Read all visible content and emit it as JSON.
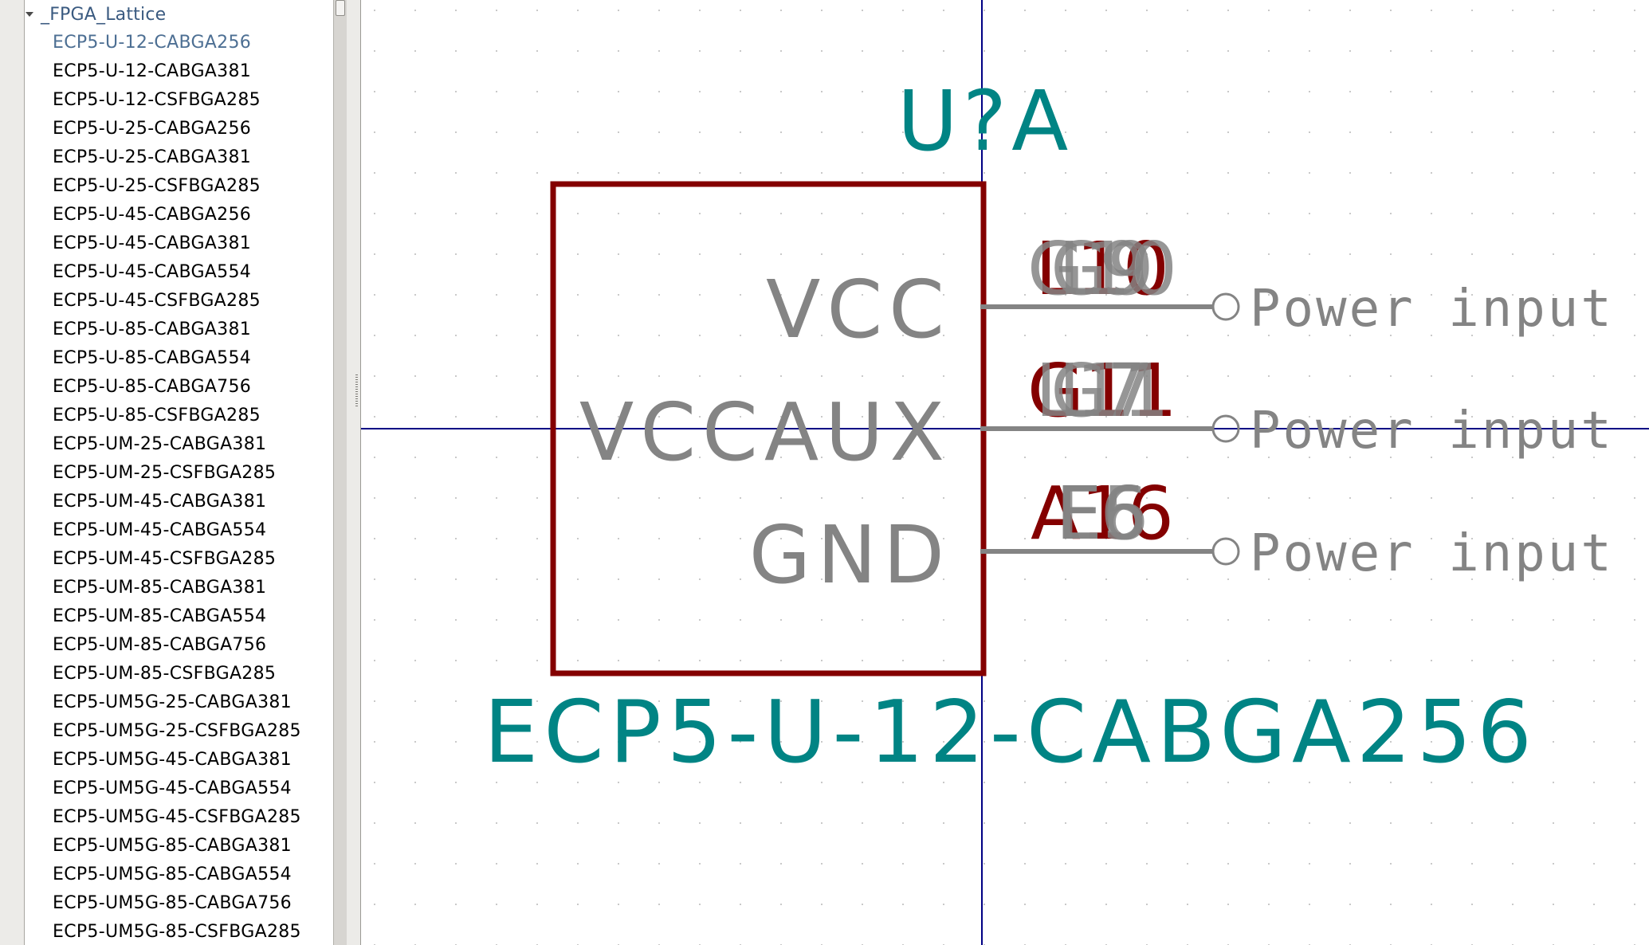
{
  "library": {
    "name": "_FPGA_Lattice",
    "expanded": true,
    "selected_index": 0,
    "items": [
      "ECP5-U-12-CABGA256",
      "ECP5-U-12-CABGA381",
      "ECP5-U-12-CSFBGA285",
      "ECP5-U-25-CABGA256",
      "ECP5-U-25-CABGA381",
      "ECP5-U-25-CSFBGA285",
      "ECP5-U-45-CABGA256",
      "ECP5-U-45-CABGA381",
      "ECP5-U-45-CABGA554",
      "ECP5-U-45-CSFBGA285",
      "ECP5-U-85-CABGA381",
      "ECP5-U-85-CABGA554",
      "ECP5-U-85-CABGA756",
      "ECP5-U-85-CSFBGA285",
      "ECP5-UM-25-CABGA381",
      "ECP5-UM-25-CSFBGA285",
      "ECP5-UM-45-CABGA381",
      "ECP5-UM-45-CABGA554",
      "ECP5-UM-45-CSFBGA285",
      "ECP5-UM-85-CABGA381",
      "ECP5-UM-85-CABGA554",
      "ECP5-UM-85-CABGA756",
      "ECP5-UM-85-CSFBGA285",
      "ECP5-UM5G-25-CABGA381",
      "ECP5-UM5G-25-CSFBGA285",
      "ECP5-UM5G-45-CABGA381",
      "ECP5-UM5G-45-CABGA554",
      "ECP5-UM5G-45-CSFBGA285",
      "ECP5-UM5G-85-CABGA381",
      "ECP5-UM5G-85-CABGA554",
      "ECP5-UM5G-85-CABGA756",
      "ECP5-UM5G-85-CSFBGA285"
    ]
  },
  "symbol": {
    "reference": "U?A",
    "value": "ECP5-U-12-CABGA256",
    "pins": [
      {
        "name": "VCC",
        "electrical_type": "Power input",
        "numbers": [
          "L10",
          "G9",
          "G10",
          "L9"
        ]
      },
      {
        "name": "VCCAUX",
        "electrical_type": "Power input",
        "numbers": [
          "G11",
          "L7",
          "L11",
          "G7"
        ]
      },
      {
        "name": "GND",
        "electrical_type": "Power input",
        "numbers": [
          "A16",
          "E5",
          "E6",
          "F6"
        ]
      }
    ]
  },
  "colors": {
    "body_outline": "#840000",
    "pin_number": "#840000",
    "reference_value": "#008484",
    "pin_line": "#848484",
    "pin_name": "#848484",
    "axis": "#000084",
    "grid_dot": "#c9c9c9",
    "tree_selected": "#4d6f93"
  }
}
